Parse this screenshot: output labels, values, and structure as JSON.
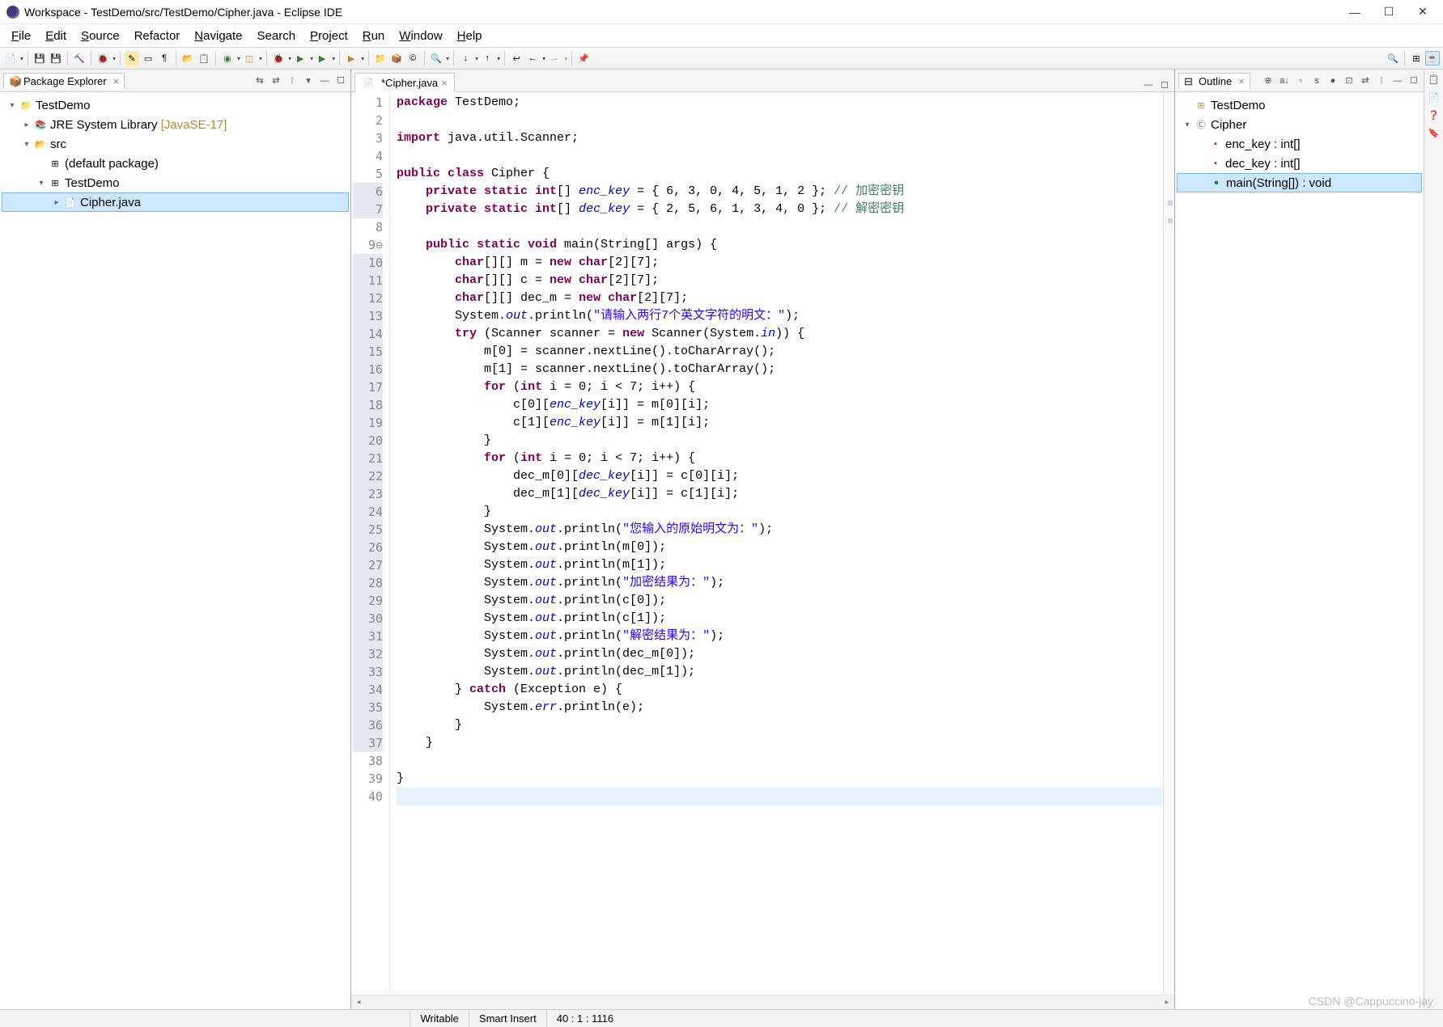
{
  "window": {
    "title": "Workspace - TestDemo/src/TestDemo/Cipher.java - Eclipse IDE"
  },
  "menu": {
    "file": "File",
    "edit": "Edit",
    "source": "Source",
    "refactor": "Refactor",
    "navigate": "Navigate",
    "search": "Search",
    "project": "Project",
    "run": "Run",
    "window": "Window",
    "help": "Help"
  },
  "package_explorer": {
    "title": "Package Explorer",
    "project": "TestDemo",
    "jre": "JRE System Library",
    "jre_profile": "[JavaSE-17]",
    "src": "src",
    "default_pkg": "(default package)",
    "pkg": "TestDemo",
    "file": "Cipher.java"
  },
  "editor": {
    "tab_name": "*Cipher.java",
    "lines": [
      {
        "n": 1,
        "tokens": [
          {
            "t": "package",
            "c": "kw"
          },
          {
            "t": " TestDemo;"
          }
        ]
      },
      {
        "n": 2,
        "tokens": []
      },
      {
        "n": 3,
        "tokens": [
          {
            "t": "import",
            "c": "kw"
          },
          {
            "t": " java.util.Scanner;"
          }
        ]
      },
      {
        "n": 4,
        "tokens": []
      },
      {
        "n": 5,
        "tokens": [
          {
            "t": "public class",
            "c": "kw"
          },
          {
            "t": " Cipher {"
          }
        ]
      },
      {
        "n": 6,
        "mark": true,
        "tokens": [
          {
            "t": "    "
          },
          {
            "t": "private static int",
            "c": "kw"
          },
          {
            "t": "[] "
          },
          {
            "t": "enc_key",
            "c": "fld"
          },
          {
            "t": " = { 6, 3, 0, 4, 5, 1, 2 }; "
          },
          {
            "t": "// 加密密钥",
            "c": "cmt"
          }
        ]
      },
      {
        "n": 7,
        "mark": true,
        "tokens": [
          {
            "t": "    "
          },
          {
            "t": "private static int",
            "c": "kw"
          },
          {
            "t": "[] "
          },
          {
            "t": "dec_key",
            "c": "fld"
          },
          {
            "t": " = { 2, 5, 6, 1, 3, 4, 0 }; "
          },
          {
            "t": "// 解密密钥",
            "c": "cmt"
          }
        ]
      },
      {
        "n": 8,
        "tokens": []
      },
      {
        "n": 9,
        "fold": true,
        "tokens": [
          {
            "t": "    "
          },
          {
            "t": "public static void",
            "c": "kw"
          },
          {
            "t": " main(String[] args) {"
          }
        ]
      },
      {
        "n": 10,
        "mark": true,
        "tokens": [
          {
            "t": "        "
          },
          {
            "t": "char",
            "c": "kw"
          },
          {
            "t": "[][] m = "
          },
          {
            "t": "new char",
            "c": "kw"
          },
          {
            "t": "[2][7];"
          }
        ]
      },
      {
        "n": 11,
        "mark": true,
        "tokens": [
          {
            "t": "        "
          },
          {
            "t": "char",
            "c": "kw"
          },
          {
            "t": "[][] c = "
          },
          {
            "t": "new char",
            "c": "kw"
          },
          {
            "t": "[2][7];"
          }
        ]
      },
      {
        "n": 12,
        "mark": true,
        "tokens": [
          {
            "t": "        "
          },
          {
            "t": "char",
            "c": "kw"
          },
          {
            "t": "[][] dec_m = "
          },
          {
            "t": "new char",
            "c": "kw"
          },
          {
            "t": "[2][7];"
          }
        ]
      },
      {
        "n": 13,
        "mark": true,
        "tokens": [
          {
            "t": "        System."
          },
          {
            "t": "out",
            "c": "sta"
          },
          {
            "t": ".println("
          },
          {
            "t": "\"请输入两行7个英文字符的明文：\"",
            "c": "str"
          },
          {
            "t": ");"
          }
        ]
      },
      {
        "n": 14,
        "mark": true,
        "tokens": [
          {
            "t": "        "
          },
          {
            "t": "try",
            "c": "kw"
          },
          {
            "t": " (Scanner scanner = "
          },
          {
            "t": "new",
            "c": "kw"
          },
          {
            "t": " Scanner(System."
          },
          {
            "t": "in",
            "c": "sta"
          },
          {
            "t": ")) {"
          }
        ]
      },
      {
        "n": 15,
        "mark": true,
        "tokens": [
          {
            "t": "            m[0] = scanner.nextLine().toCharArray();"
          }
        ]
      },
      {
        "n": 16,
        "mark": true,
        "tokens": [
          {
            "t": "            m[1] = scanner.nextLine().toCharArray();"
          }
        ]
      },
      {
        "n": 17,
        "mark": true,
        "tokens": [
          {
            "t": "            "
          },
          {
            "t": "for",
            "c": "kw"
          },
          {
            "t": " ("
          },
          {
            "t": "int",
            "c": "kw"
          },
          {
            "t": " i = 0; i < 7; i++) {"
          }
        ]
      },
      {
        "n": 18,
        "mark": true,
        "tokens": [
          {
            "t": "                c[0]["
          },
          {
            "t": "enc_key",
            "c": "fld"
          },
          {
            "t": "[i]] = m[0][i];"
          }
        ]
      },
      {
        "n": 19,
        "mark": true,
        "tokens": [
          {
            "t": "                c[1]["
          },
          {
            "t": "enc_key",
            "c": "fld"
          },
          {
            "t": "[i]] = m[1][i];"
          }
        ]
      },
      {
        "n": 20,
        "mark": true,
        "tokens": [
          {
            "t": "            }"
          }
        ]
      },
      {
        "n": 21,
        "mark": true,
        "tokens": [
          {
            "t": "            "
          },
          {
            "t": "for",
            "c": "kw"
          },
          {
            "t": " ("
          },
          {
            "t": "int",
            "c": "kw"
          },
          {
            "t": " i = 0; i < 7; i++) {"
          }
        ]
      },
      {
        "n": 22,
        "mark": true,
        "tokens": [
          {
            "t": "                dec_m[0]["
          },
          {
            "t": "dec_key",
            "c": "fld"
          },
          {
            "t": "[i]] = c[0][i];"
          }
        ]
      },
      {
        "n": 23,
        "mark": true,
        "tokens": [
          {
            "t": "                dec_m[1]["
          },
          {
            "t": "dec_key",
            "c": "fld"
          },
          {
            "t": "[i]] = c[1][i];"
          }
        ]
      },
      {
        "n": 24,
        "mark": true,
        "tokens": [
          {
            "t": "            }"
          }
        ]
      },
      {
        "n": 25,
        "mark": true,
        "tokens": [
          {
            "t": "            System."
          },
          {
            "t": "out",
            "c": "sta"
          },
          {
            "t": ".println("
          },
          {
            "t": "\"您输入的原始明文为：\"",
            "c": "str"
          },
          {
            "t": ");"
          }
        ]
      },
      {
        "n": 26,
        "mark": true,
        "tokens": [
          {
            "t": "            System."
          },
          {
            "t": "out",
            "c": "sta"
          },
          {
            "t": ".println(m[0]);"
          }
        ]
      },
      {
        "n": 27,
        "mark": true,
        "tokens": [
          {
            "t": "            System."
          },
          {
            "t": "out",
            "c": "sta"
          },
          {
            "t": ".println(m[1]);"
          }
        ]
      },
      {
        "n": 28,
        "mark": true,
        "tokens": [
          {
            "t": "            System."
          },
          {
            "t": "out",
            "c": "sta"
          },
          {
            "t": ".println("
          },
          {
            "t": "\"加密结果为：\"",
            "c": "str"
          },
          {
            "t": ");"
          }
        ]
      },
      {
        "n": 29,
        "mark": true,
        "tokens": [
          {
            "t": "            System."
          },
          {
            "t": "out",
            "c": "sta"
          },
          {
            "t": ".println(c[0]);"
          }
        ]
      },
      {
        "n": 30,
        "mark": true,
        "tokens": [
          {
            "t": "            System."
          },
          {
            "t": "out",
            "c": "sta"
          },
          {
            "t": ".println(c[1]);"
          }
        ]
      },
      {
        "n": 31,
        "mark": true,
        "tokens": [
          {
            "t": "            System."
          },
          {
            "t": "out",
            "c": "sta"
          },
          {
            "t": ".println("
          },
          {
            "t": "\"解密结果为：\"",
            "c": "str"
          },
          {
            "t": ");"
          }
        ]
      },
      {
        "n": 32,
        "mark": true,
        "tokens": [
          {
            "t": "            System."
          },
          {
            "t": "out",
            "c": "sta"
          },
          {
            "t": ".println(dec_m[0]);"
          }
        ]
      },
      {
        "n": 33,
        "mark": true,
        "tokens": [
          {
            "t": "            System."
          },
          {
            "t": "out",
            "c": "sta"
          },
          {
            "t": ".println(dec_m[1]);"
          }
        ]
      },
      {
        "n": 34,
        "mark": true,
        "tokens": [
          {
            "t": "        } "
          },
          {
            "t": "catch",
            "c": "kw"
          },
          {
            "t": " (Exception e) {"
          }
        ]
      },
      {
        "n": 35,
        "mark": true,
        "tokens": [
          {
            "t": "            System."
          },
          {
            "t": "err",
            "c": "sta"
          },
          {
            "t": ".println(e);"
          }
        ]
      },
      {
        "n": 36,
        "mark": true,
        "tokens": [
          {
            "t": "        }"
          }
        ]
      },
      {
        "n": 37,
        "mark": true,
        "tokens": [
          {
            "t": "    }"
          }
        ]
      },
      {
        "n": 38,
        "tokens": []
      },
      {
        "n": 39,
        "tokens": [
          {
            "t": "}"
          }
        ]
      },
      {
        "n": 40,
        "current": true,
        "tokens": []
      }
    ]
  },
  "outline": {
    "title": "Outline",
    "pkg": "TestDemo",
    "class": "Cipher",
    "members": [
      {
        "icon": "field",
        "label": "enc_key : int[]"
      },
      {
        "icon": "field",
        "label": "dec_key : int[]"
      },
      {
        "icon": "method",
        "label": "main(String[]) : void",
        "selected": true
      }
    ]
  },
  "statusbar": {
    "writable": "Writable",
    "insert": "Smart Insert",
    "cursor": "40 : 1 : 1116"
  },
  "watermark": "CSDN @Cappuccino-jay"
}
